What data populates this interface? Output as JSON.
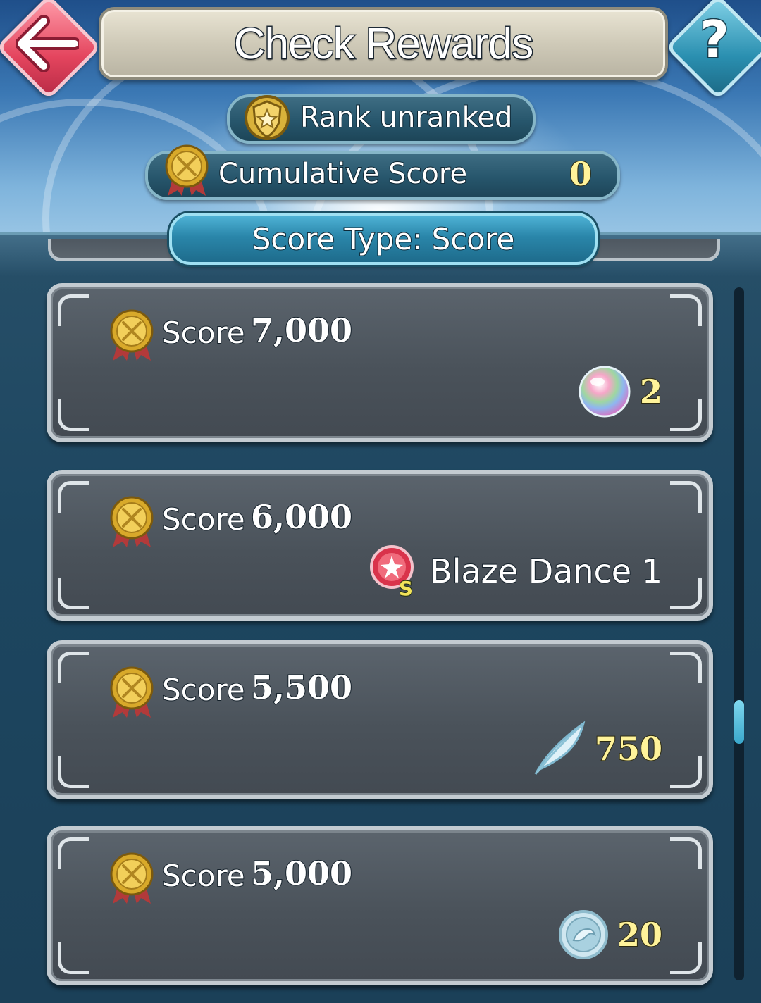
{
  "header": {
    "title": "Check Rewards",
    "back_icon": "back-arrow-icon",
    "help_icon": "help-question-icon",
    "help_label": "?"
  },
  "rank": {
    "label": "Rank  unranked"
  },
  "cumulative": {
    "label": "Cumulative Score",
    "value": "0"
  },
  "score_type": {
    "label": "Score Type: Score"
  },
  "rewards": [
    {
      "score_label": "Score",
      "score_value": "7,000",
      "reward_icon": "orb-icon",
      "reward_text": "2"
    },
    {
      "score_label": "Score",
      "score_value": "6,000",
      "reward_icon": "skill-scroll-icon",
      "reward_badge": "S",
      "reward_text": "Blaze Dance 1"
    },
    {
      "score_label": "Score",
      "score_value": "5,500",
      "reward_icon": "feather-icon",
      "reward_text": "750"
    },
    {
      "score_label": "Score",
      "score_value": "5,000",
      "reward_icon": "coin-icon",
      "reward_text": "20"
    }
  ],
  "colors": {
    "accent_gold": "#fff39a",
    "back_button": "#e4455e",
    "help_button": "#2a8fb0",
    "tab_active": "#2a86aa",
    "card_bg": "#4a525a"
  }
}
